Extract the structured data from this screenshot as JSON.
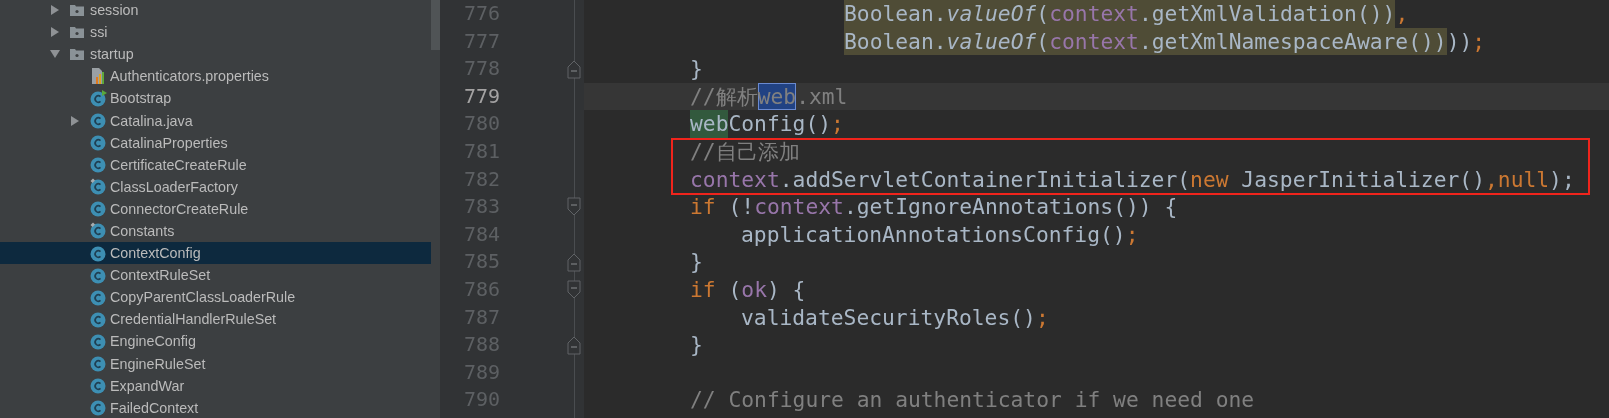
{
  "sidebar": {
    "items": [
      {
        "label": "session",
        "kind": "folder",
        "expanded": false,
        "selected": false
      },
      {
        "label": "ssi",
        "kind": "folder",
        "expanded": false,
        "selected": false
      },
      {
        "label": "startup",
        "kind": "folder",
        "expanded": true,
        "selected": false,
        "children": [
          {
            "label": "Authenticators.properties",
            "kind": "properties",
            "selected": false
          },
          {
            "label": "Bootstrap",
            "kind": "runnable",
            "selected": false
          },
          {
            "label": "Catalina.java",
            "kind": "class",
            "expanded": false,
            "selected": false
          },
          {
            "label": "CatalinaProperties",
            "kind": "class",
            "selected": false
          },
          {
            "label": "CertificateCreateRule",
            "kind": "class",
            "selected": false
          },
          {
            "label": "ClassLoaderFactory",
            "kind": "final",
            "selected": false
          },
          {
            "label": "ConnectorCreateRule",
            "kind": "class",
            "selected": false
          },
          {
            "label": "Constants",
            "kind": "final",
            "selected": false
          },
          {
            "label": "ContextConfig",
            "kind": "class",
            "selected": true
          },
          {
            "label": "ContextRuleSet",
            "kind": "class",
            "selected": false
          },
          {
            "label": "CopyParentClassLoaderRule",
            "kind": "class",
            "selected": false
          },
          {
            "label": "CredentialHandlerRuleSet",
            "kind": "class",
            "selected": false
          },
          {
            "label": "EngineConfig",
            "kind": "class",
            "selected": false
          },
          {
            "label": "EngineRuleSet",
            "kind": "class",
            "selected": false
          },
          {
            "label": "ExpandWar",
            "kind": "class",
            "selected": false
          },
          {
            "label": "FailedContext",
            "kind": "class",
            "selected": false
          }
        ]
      }
    ]
  },
  "editor": {
    "lines": [
      {
        "number": "776",
        "kind": "continuation",
        "current": false,
        "boxed": false,
        "segments": [
          {
            "text": "Boolean.",
            "kind": "plain",
            "warning": true
          },
          {
            "text": "valueOf",
            "kind": "static",
            "warning": true
          },
          {
            "text": "(",
            "kind": "plain",
            "warning": true
          },
          {
            "text": "context",
            "kind": "field",
            "warning": true
          },
          {
            "text": ".getXmlValidation())",
            "kind": "plain",
            "warning": true
          },
          {
            "text": ",",
            "kind": "keyword",
            "warning": false
          }
        ]
      },
      {
        "number": "777",
        "kind": "continuation",
        "current": false,
        "boxed": false,
        "segments": [
          {
            "text": "Boolean.",
            "kind": "plain",
            "warning": true
          },
          {
            "text": "valueOf",
            "kind": "static",
            "warning": true
          },
          {
            "text": "(",
            "kind": "plain",
            "warning": true
          },
          {
            "text": "context",
            "kind": "field",
            "warning": true
          },
          {
            "text": ".getXmlNamespaceAware())",
            "kind": "plain",
            "warning": true
          },
          {
            "text": "))",
            "kind": "plain",
            "warning": false
          },
          {
            "text": ";",
            "kind": "keyword",
            "warning": false
          }
        ]
      },
      {
        "number": "778",
        "kind": "statement",
        "current": false,
        "boxed": false,
        "fold_end": true,
        "segments": [
          {
            "text": "}",
            "kind": "plain"
          }
        ]
      },
      {
        "number": "779",
        "kind": "statement",
        "current": true,
        "boxed": false,
        "segments": [
          {
            "text": "//解析",
            "kind": "comment",
            "selected": false
          },
          {
            "text": "web",
            "kind": "comment",
            "selected": true
          },
          {
            "text": ".xml",
            "kind": "comment",
            "selected": false
          }
        ]
      },
      {
        "number": "780",
        "kind": "statement",
        "current": false,
        "boxed": false,
        "segments": [
          {
            "text": "web",
            "kind": "plain",
            "match": true
          },
          {
            "text": "Config()",
            "kind": "plain",
            "match": false
          },
          {
            "text": ";",
            "kind": "keyword",
            "match": false
          }
        ]
      },
      {
        "number": "781",
        "kind": "statement",
        "current": false,
        "boxed": true,
        "segments": [
          {
            "text": "//自己添加",
            "kind": "comment"
          }
        ]
      },
      {
        "number": "782",
        "kind": "statement",
        "current": false,
        "boxed": true,
        "segments": [
          {
            "text": "context",
            "kind": "field"
          },
          {
            "text": ".addServletContainerInitializer(",
            "kind": "plain"
          },
          {
            "text": "new",
            "kind": "keyword"
          },
          {
            "text": " JasperInitializer()",
            "kind": "plain"
          },
          {
            "text": ",null",
            "kind": "keyword"
          },
          {
            "text": ");",
            "kind": "plain"
          }
        ]
      },
      {
        "number": "783",
        "kind": "statement",
        "current": false,
        "boxed": false,
        "fold_start": true,
        "segments": [
          {
            "text": "if",
            "kind": "keyword"
          },
          {
            "text": " (!",
            "kind": "plain"
          },
          {
            "text": "context",
            "kind": "field"
          },
          {
            "text": ".getIgnoreAnnotations()) {",
            "kind": "plain"
          }
        ]
      },
      {
        "number": "784",
        "kind": "nested",
        "current": false,
        "boxed": false,
        "segments": [
          {
            "text": "applicationAnnotationsConfig()",
            "kind": "plain"
          },
          {
            "text": ";",
            "kind": "keyword"
          }
        ]
      },
      {
        "number": "785",
        "kind": "statement",
        "current": false,
        "boxed": false,
        "fold_end": true,
        "segments": [
          {
            "text": "}",
            "kind": "plain"
          }
        ]
      },
      {
        "number": "786",
        "kind": "statement",
        "current": false,
        "boxed": false,
        "fold_start": true,
        "segments": [
          {
            "text": "if",
            "kind": "keyword"
          },
          {
            "text": " (",
            "kind": "plain"
          },
          {
            "text": "ok",
            "kind": "field"
          },
          {
            "text": ") {",
            "kind": "plain"
          }
        ]
      },
      {
        "number": "787",
        "kind": "nested",
        "current": false,
        "boxed": false,
        "segments": [
          {
            "text": "validateSecurityRoles()",
            "kind": "plain"
          },
          {
            "text": ";",
            "kind": "keyword"
          }
        ]
      },
      {
        "number": "788",
        "kind": "statement",
        "current": false,
        "boxed": false,
        "fold_end": true,
        "segments": [
          {
            "text": "}",
            "kind": "plain"
          }
        ]
      },
      {
        "number": "789",
        "kind": "statement",
        "current": false,
        "boxed": false
      },
      {
        "number": "790",
        "kind": "statement",
        "current": false,
        "boxed": false,
        "segments": [
          {
            "text": "// Configure an authenticator if we need one",
            "kind": "comment"
          }
        ]
      }
    ]
  }
}
